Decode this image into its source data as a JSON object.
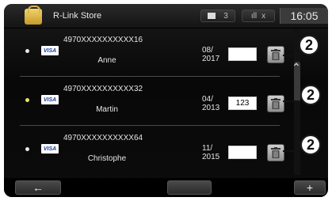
{
  "header": {
    "title": "R-Link Store",
    "icon": "store-bag-icon",
    "indicator_label": "3",
    "signal_label": "x",
    "time": "16:05"
  },
  "cards": [
    {
      "brand": "VISA",
      "number": "4970XXXXXXXXXX16",
      "holder": "Anne",
      "expiry_month": "08/",
      "expiry_year": "2017",
      "cvv": ""
    },
    {
      "brand": "VISA",
      "number": "4970XXXXXXXXXX32",
      "holder": "Martin",
      "expiry_month": "04/",
      "expiry_year": "2013",
      "cvv": "123"
    },
    {
      "brand": "VISA",
      "number": "4970XXXXXXXXXX64",
      "holder": "Christophe",
      "expiry_month": "11/",
      "expiry_year": "2015",
      "cvv": ""
    }
  ],
  "callouts": [
    "2",
    "2",
    "2"
  ],
  "footer": {
    "back_label": "←",
    "add_label": "+"
  },
  "colors": {
    "background": "#0c0c0c",
    "text": "#e6e6e6"
  }
}
